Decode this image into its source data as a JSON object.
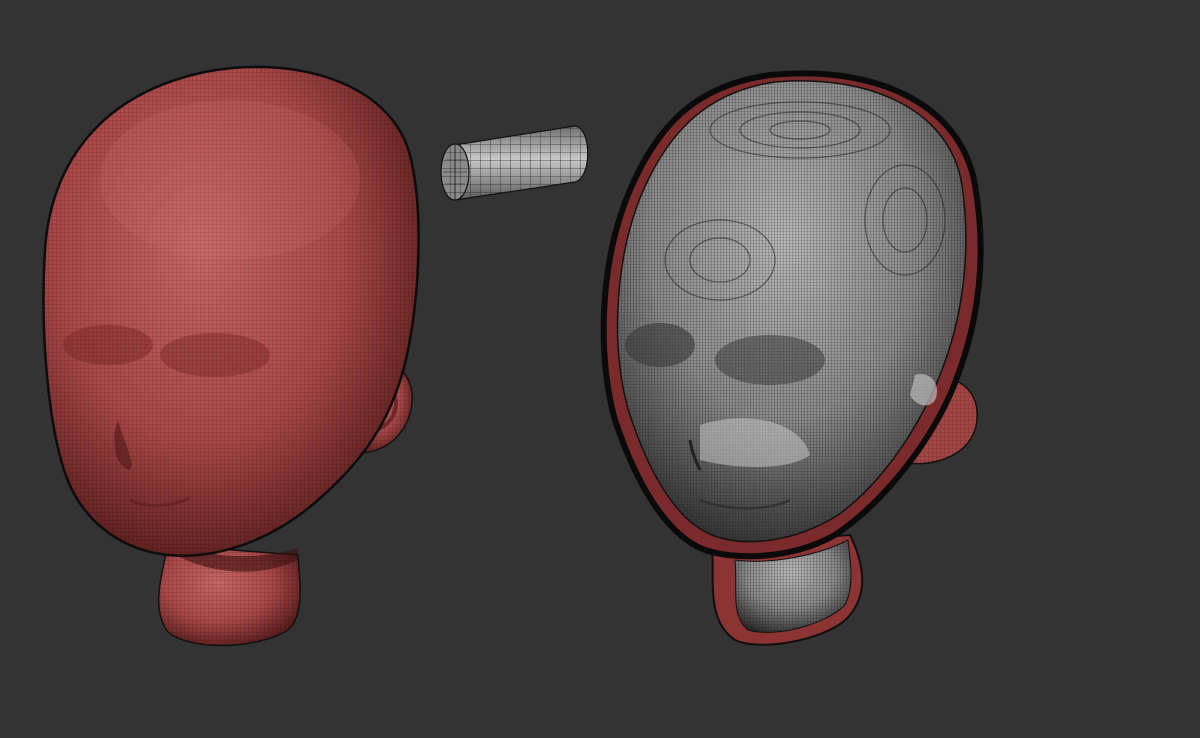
{
  "viewport": {
    "background_color": "#333333"
  },
  "objects": [
    {
      "name": "original-head-mesh",
      "description_icon": "head-mesh-icon",
      "color": "#b14f4f",
      "wireframe": true
    },
    {
      "name": "cylinder-mesh",
      "description_icon": "cylinder-mesh-icon",
      "color": "#9a9a9a",
      "wireframe": true
    },
    {
      "name": "voxel-head-mesh",
      "description_icon": "voxel-head-icon",
      "color": "#8e8e8e",
      "outline_color": "#8c3434",
      "wireframe": true
    }
  ]
}
